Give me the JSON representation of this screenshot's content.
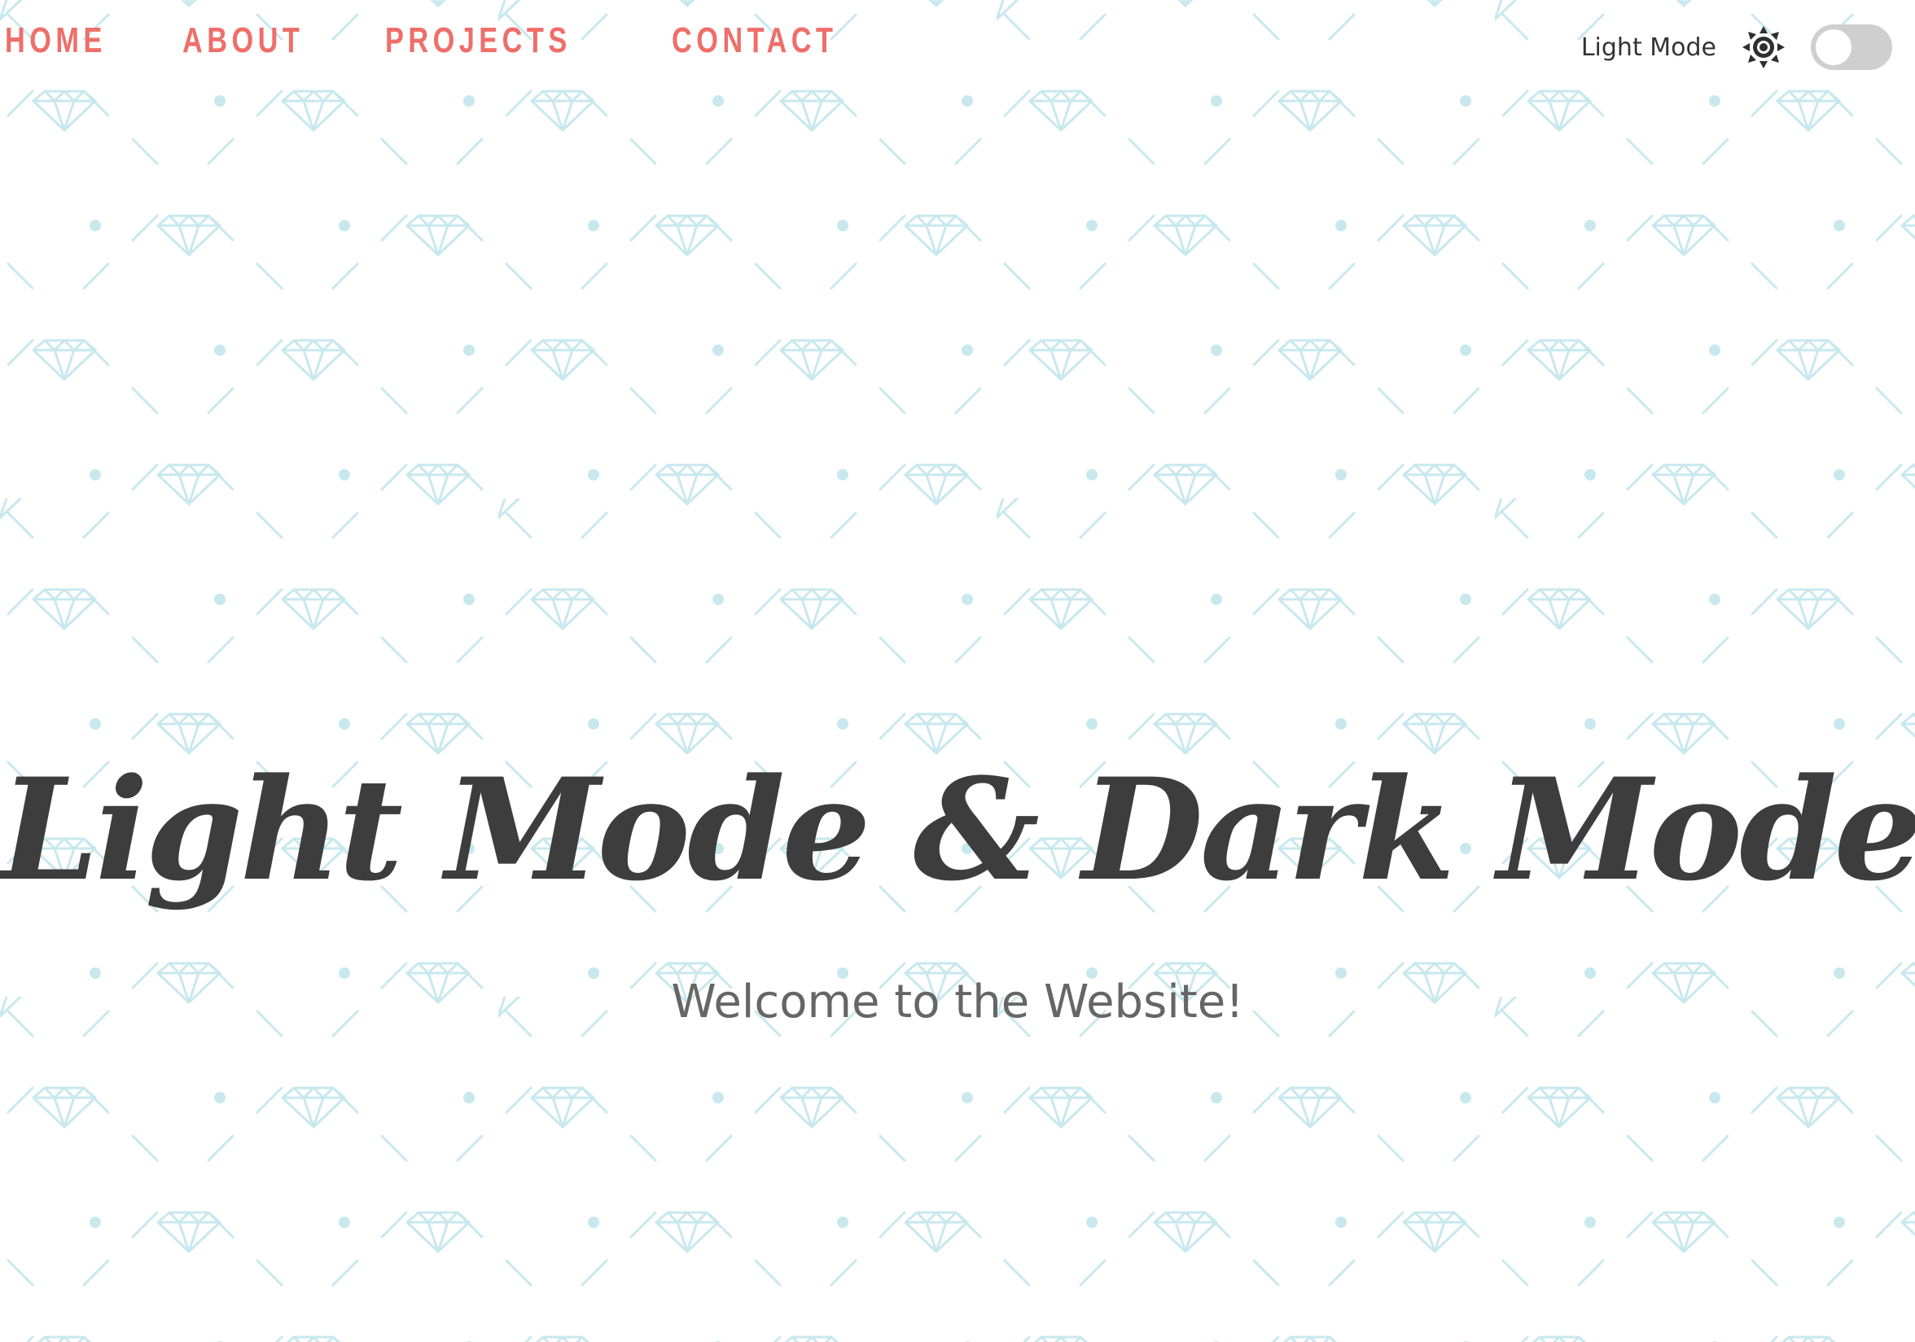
{
  "nav": {
    "items": [
      {
        "label": "HOME"
      },
      {
        "label": "ABOUT"
      },
      {
        "label": "PROJECTS"
      },
      {
        "label": "CONTACT"
      }
    ]
  },
  "theme_switch": {
    "label": "Light Mode",
    "icon": "sun-icon",
    "enabled": false
  },
  "hero": {
    "title": "Light Mode & Dark Mode",
    "subtitle": "Welcome to the Website!"
  },
  "colors": {
    "background": "#ffffff",
    "nav_text": "#ee6e6a",
    "title_text": "#3d3d3d",
    "subtitle_text": "#666666",
    "pattern": "#c8e8ee",
    "toggle_track": "#cfcfcf"
  }
}
